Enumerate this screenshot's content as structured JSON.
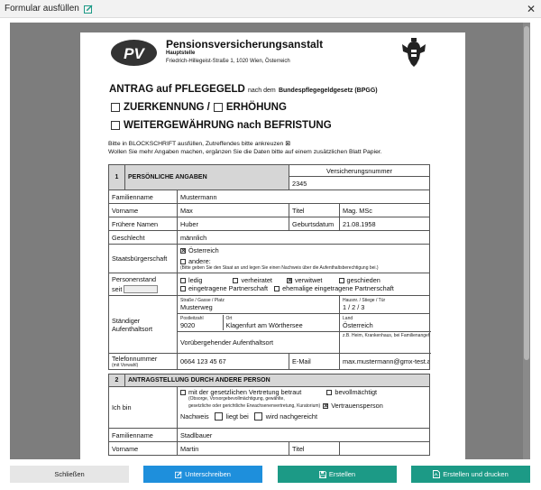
{
  "dialog": {
    "title": "Formular ausfüllen",
    "close_glyph": "✕"
  },
  "header": {
    "org_name": "Pensionsversicherungsanstalt",
    "org_sub": "Hauptstelle",
    "org_address": "Friedrich-Hillegeist-Straße 1, 1020 Wien, Österreich"
  },
  "form_title": {
    "main": "ANTRAG auf PFLEGEGELD",
    "connector": "nach dem",
    "law": "Bundespflegegeldgesetz (BPGG)",
    "option1a": "ZUERKENNUNG /",
    "option1b": "ERHÖHUNG",
    "option2": "WEITERGEWÄHRUNG nach BEFRISTUNG"
  },
  "instructions": {
    "line1": "Bitte in BLOCKSCHRIFT ausfüllen, Zutreffendes bitte ankreuzen ⊠",
    "line2": "Wollen Sie mehr Angaben machen, ergänzen Sie die Daten bitte auf einem zusätzlichen Blatt Papier."
  },
  "section1": {
    "number": "1",
    "title": "PERSÖNLICHE ANGABEN",
    "insurance_label": "Versicherungsnummer",
    "insurance_value": "2345",
    "familienname_label": "Familienname",
    "familienname_value": "Mustermann",
    "vorname_label": "Vorname",
    "vorname_value": "Max",
    "titel_label": "Titel",
    "titel_value": "Mag. MSc",
    "fruehere_label": "Frühere Namen",
    "fruehere_value": "Huber",
    "geburt_label": "Geburtsdatum",
    "geburt_value": "21.08.1958",
    "geschlecht_label": "Geschlecht",
    "geschlecht_value": "männlich",
    "staat_label": "Staatsbürgerschaft",
    "staat_opt1": "Österreich",
    "staat_opt2": "andere:",
    "staat_hint": "(Bitte geben Sie den Staat an und legen Sie einen Nachweis über die Aufenthaltsberechtigung bei.)",
    "personenstand_label": "Personenstand",
    "seit_label": "seit",
    "ps_ledig": "ledig",
    "ps_verheiratet": "verheiratet",
    "ps_verwitwet": "verwitwet",
    "ps_geschieden": "geschieden",
    "ps_eingetragen": "eingetragene Partnerschaft",
    "ps_ehemalige": "ehemalige eingetragene Partnerschaft",
    "aufenthalt_label": "Ständiger Aufenthaltsort",
    "strasse_label": "Straße / Gasse / Platz",
    "strasse_value": "Musterweg",
    "hausnr_label": "Hausnr. / Stiege / Tür",
    "hausnr_value": "1 / 2 / 3",
    "plz_label": "Postleitzahl",
    "plz_value": "9020",
    "ort_label": "Ort",
    "ort_value": "Klagenfurt am Wörthersee",
    "land_label": "Land",
    "land_value": "Österreich",
    "voruebergehend_label": "Vorübergehender Aufenthaltsort",
    "voruebergehend_hint": "z.B. Heim, Krankenhaus, bei Familienangehörigen; Bitte geben Sie die genaue Adresse bekannt.",
    "telefon_label": "Telefonnummer",
    "telefon_sub": "(mit Vorwahl)",
    "telefon_value": "0664 123 45 67",
    "email_label": "E-Mail",
    "email_value": "max.mustermann@gmx-test.at"
  },
  "section2": {
    "number": "2",
    "title": "ANTRAGSTELLUNG DURCH ANDERE PERSON",
    "ich_bin_label": "Ich bin",
    "opt_vertretung": "mit der gesetzlichen Vertretung betraut",
    "opt_vertretung_hint1": "(Obsorge, Vorsorgebevollmächtigung, gewählte,",
    "opt_vertretung_hint2": "gesetzliche oder gerichtliche Erwachsenenvertretung, Kuratorium)",
    "opt_bevollmaechtigt": "bevollmächtigt",
    "opt_vertrauensperson": "Vertrauensperson",
    "nachweis_label": "Nachweis",
    "nachweis_opt1": "liegt bei",
    "nachweis_opt2": "wird nachgereicht",
    "familienname_label": "Familienname",
    "familienname_value": "Stadlbauer",
    "vorname_label": "Vorname",
    "vorname_value": "Martin",
    "titel_label": "Titel"
  },
  "footer": {
    "close_label": "Schließen",
    "rewrite_label": "Unterschreiben",
    "create_label": "Erstellen",
    "create_print_label": "Erstellen und drucken"
  },
  "colors": {
    "primary": "#1e8fdc",
    "success": "#1c9a86",
    "neutral": "#e6e6e6",
    "viewer_bg": "#7d7d7d",
    "section_head": "#d6d6d6"
  },
  "icons": {
    "title_edit": "edit-square-icon",
    "rewrite": "pencil-square-icon",
    "create": "save-icon",
    "create_print": "file-pdf-icon"
  }
}
